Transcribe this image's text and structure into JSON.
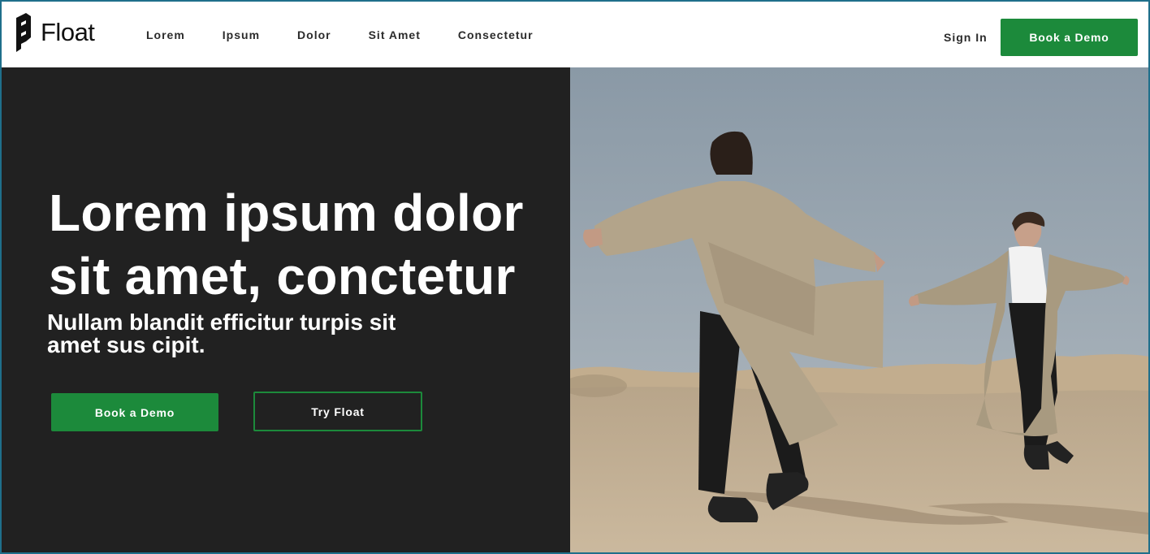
{
  "brand": {
    "name": "Float",
    "accent": "#1c8a3b",
    "dark_bg": "#212121"
  },
  "nav": {
    "items": [
      {
        "label": "Lorem"
      },
      {
        "label": "Ipsum"
      },
      {
        "label": "Dolor"
      },
      {
        "label": "Sit Amet"
      },
      {
        "label": "Consectetur"
      }
    ],
    "sign_in": "Sign In",
    "cta": "Book a Demo"
  },
  "hero": {
    "title": "Lorem ipsum dolor sit amet, conctetur",
    "subtitle": "Nullam blandit efficitur turpis sit amet sus cipit.",
    "primary_button": "Book a Demo",
    "secondary_button": "Try Float"
  },
  "photo": {
    "icon": "two-people-dancing-desert-photo"
  }
}
